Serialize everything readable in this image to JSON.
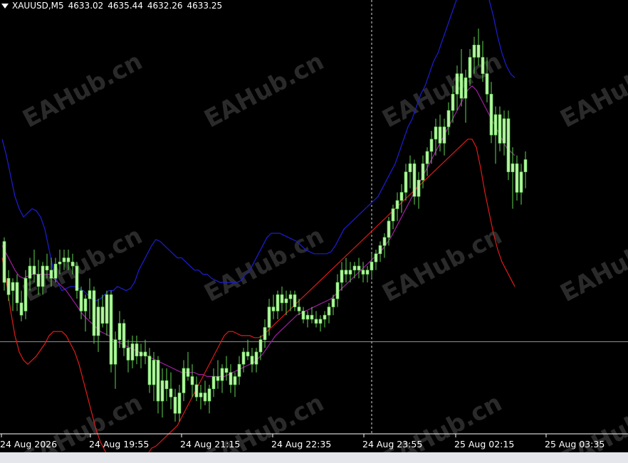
{
  "header": {
    "symbol": "XAUUSD,M5",
    "open": "4633.02",
    "high": "4635.44",
    "low": "4632.26",
    "close": "4633.25"
  },
  "colors": {
    "background": "#000000",
    "candle": "#b4f5a0",
    "wick": "#5fd34f",
    "upper_band": "#1d1dd6",
    "middle_band": "#a01da3",
    "lower_band": "#e01a1a",
    "grid_line": "#8a8f9c",
    "watermark": "#2a2a2a"
  },
  "watermark": "EAHub.cn",
  "chart_data": {
    "type": "candlestick",
    "symbol": "XAUUSD",
    "timeframe": "M5",
    "x_ticks": [
      "24 Aug 2026",
      "24 Aug 19:55",
      "24 Aug 21:15",
      "24 Aug 22:35",
      "24 Aug 23:55",
      "25 Aug 02:15",
      "25 Aug 03:35"
    ],
    "bar_spacing": 6,
    "candles": [
      [
        4674,
        4676,
        4650,
        4654
      ],
      [
        4656,
        4660,
        4645,
        4648
      ],
      [
        4650,
        4656,
        4640,
        4654
      ],
      [
        4654,
        4658,
        4640,
        4644
      ],
      [
        4644,
        4650,
        4635,
        4638
      ],
      [
        4640,
        4660,
        4636,
        4656
      ],
      [
        4656,
        4666,
        4650,
        4662
      ],
      [
        4662,
        4670,
        4654,
        4658
      ],
      [
        4658,
        4665,
        4648,
        4652
      ],
      [
        4652,
        4664,
        4648,
        4662
      ],
      [
        4662,
        4668,
        4656,
        4660
      ],
      [
        4660,
        4666,
        4652,
        4656
      ],
      [
        4656,
        4666,
        4654,
        4663
      ],
      [
        4663,
        4670,
        4658,
        4664
      ],
      [
        4664,
        4670,
        4660,
        4666
      ],
      [
        4666,
        4670,
        4660,
        4664
      ],
      [
        4664,
        4668,
        4658,
        4662
      ],
      [
        4662,
        4664,
        4646,
        4650
      ],
      [
        4650,
        4652,
        4636,
        4640
      ],
      [
        4640,
        4648,
        4630,
        4646
      ],
      [
        4646,
        4656,
        4636,
        4650
      ],
      [
        4650,
        4652,
        4624,
        4628
      ],
      [
        4628,
        4646,
        4620,
        4642
      ],
      [
        4642,
        4648,
        4632,
        4634
      ],
      [
        4634,
        4650,
        4628,
        4648
      ],
      [
        4648,
        4650,
        4610,
        4614
      ],
      [
        4614,
        4630,
        4602,
        4626
      ],
      [
        4626,
        4640,
        4622,
        4634
      ],
      [
        4634,
        4636,
        4618,
        4622
      ],
      [
        4622,
        4626,
        4610,
        4616
      ],
      [
        4616,
        4628,
        4612,
        4624
      ],
      [
        4624,
        4628,
        4614,
        4618
      ],
      [
        4618,
        4624,
        4612,
        4620
      ],
      [
        4620,
        4626,
        4614,
        4618
      ],
      [
        4618,
        4622,
        4600,
        4604
      ],
      [
        4604,
        4620,
        4596,
        4616
      ],
      [
        4616,
        4618,
        4590,
        4596
      ],
      [
        4596,
        4612,
        4588,
        4606
      ],
      [
        4606,
        4612,
        4596,
        4602
      ],
      [
        4602,
        4610,
        4592,
        4598
      ],
      [
        4598,
        4602,
        4586,
        4590
      ],
      [
        4590,
        4604,
        4586,
        4600
      ],
      [
        4600,
        4616,
        4596,
        4612
      ],
      [
        4612,
        4620,
        4606,
        4608
      ],
      [
        4608,
        4614,
        4598,
        4604
      ],
      [
        4604,
        4608,
        4596,
        4598
      ],
      [
        4598,
        4604,
        4592,
        4600
      ],
      [
        4600,
        4606,
        4594,
        4596
      ],
      [
        4596,
        4604,
        4590,
        4602
      ],
      [
        4602,
        4612,
        4598,
        4608
      ],
      [
        4608,
        4616,
        4602,
        4606
      ],
      [
        4606,
        4614,
        4600,
        4612
      ],
      [
        4612,
        4618,
        4606,
        4610
      ],
      [
        4610,
        4614,
        4600,
        4604
      ],
      [
        4604,
        4610,
        4598,
        4608
      ],
      [
        4608,
        4618,
        4604,
        4614
      ],
      [
        4614,
        4622,
        4610,
        4620
      ],
      [
        4620,
        4626,
        4616,
        4618
      ],
      [
        4618,
        4622,
        4610,
        4614
      ],
      [
        4614,
        4622,
        4610,
        4620
      ],
      [
        4620,
        4628,
        4616,
        4626
      ],
      [
        4626,
        4636,
        4622,
        4632
      ],
      [
        4632,
        4646,
        4628,
        4642
      ],
      [
        4642,
        4648,
        4636,
        4640
      ],
      [
        4640,
        4650,
        4636,
        4648
      ],
      [
        4648,
        4652,
        4640,
        4644
      ],
      [
        4644,
        4650,
        4638,
        4646
      ],
      [
        4646,
        4650,
        4640,
        4648
      ],
      [
        4648,
        4650,
        4640,
        4642
      ],
      [
        4642,
        4646,
        4638,
        4640
      ],
      [
        4640,
        4642,
        4634,
        4636
      ],
      [
        4636,
        4640,
        4632,
        4638
      ],
      [
        4638,
        4642,
        4634,
        4636
      ],
      [
        4636,
        4640,
        4632,
        4634
      ],
      [
        4634,
        4638,
        4630,
        4636
      ],
      [
        4636,
        4640,
        4632,
        4638
      ],
      [
        4638,
        4644,
        4634,
        4642
      ],
      [
        4642,
        4648,
        4638,
        4646
      ],
      [
        4646,
        4658,
        4642,
        4654
      ],
      [
        4654,
        4664,
        4650,
        4660
      ],
      [
        4660,
        4666,
        4654,
        4658
      ],
      [
        4658,
        4664,
        4654,
        4660
      ],
      [
        4660,
        4664,
        4656,
        4662
      ],
      [
        4662,
        4666,
        4656,
        4660
      ],
      [
        4660,
        4664,
        4654,
        4658
      ],
      [
        4658,
        4662,
        4654,
        4660
      ],
      [
        4660,
        4668,
        4656,
        4664
      ],
      [
        4664,
        4670,
        4660,
        4668
      ],
      [
        4668,
        4674,
        4664,
        4672
      ],
      [
        4672,
        4678,
        4666,
        4676
      ],
      [
        4676,
        4686,
        4672,
        4684
      ],
      [
        4684,
        4692,
        4680,
        4690
      ],
      [
        4690,
        4698,
        4684,
        4694
      ],
      [
        4694,
        4702,
        4688,
        4698
      ],
      [
        4698,
        4712,
        4694,
        4708
      ],
      [
        4708,
        4716,
        4700,
        4712
      ],
      [
        4712,
        4714,
        4692,
        4696
      ],
      [
        4696,
        4708,
        4690,
        4704
      ],
      [
        4704,
        4716,
        4700,
        4712
      ],
      [
        4712,
        4720,
        4706,
        4718
      ],
      [
        4718,
        4728,
        4712,
        4724
      ],
      [
        4724,
        4734,
        4716,
        4730
      ],
      [
        4730,
        4736,
        4718,
        4722
      ],
      [
        4722,
        4734,
        4716,
        4730
      ],
      [
        4730,
        4742,
        4726,
        4738
      ],
      [
        4738,
        4750,
        4732,
        4746
      ],
      [
        4746,
        4760,
        4738,
        4756
      ],
      [
        4756,
        4768,
        4740,
        4744
      ],
      [
        4744,
        4758,
        4732,
        4754
      ],
      [
        4754,
        4768,
        4750,
        4764
      ],
      [
        4764,
        4774,
        4756,
        4770
      ],
      [
        4770,
        4778,
        4760,
        4764
      ],
      [
        4764,
        4772,
        4752,
        4756
      ],
      [
        4756,
        4764,
        4742,
        4746
      ],
      [
        4746,
        4752,
        4722,
        4726
      ],
      [
        4726,
        4740,
        4712,
        4736
      ],
      [
        4736,
        4740,
        4718,
        4722
      ],
      [
        4722,
        4738,
        4716,
        4734
      ],
      [
        4734,
        4738,
        4704,
        4708
      ],
      [
        4708,
        4720,
        4690,
        4712
      ],
      [
        4712,
        4716,
        4694,
        4698
      ],
      [
        4698,
        4712,
        4692,
        4708
      ],
      [
        4708,
        4718,
        4700,
        4714
      ]
    ],
    "bands": {
      "period_note": "Bollinger Bands",
      "upper": [
        4724,
        4716,
        4706,
        4696,
        4690,
        4686,
        4688,
        4690,
        4689,
        4686,
        4680,
        4670,
        4660,
        4654,
        4650,
        4651,
        4652,
        4652,
        4651,
        4650,
        4648,
        4646,
        4645,
        4646,
        4648,
        4650,
        4650,
        4652,
        4651,
        4650,
        4651,
        4654,
        4660,
        4664,
        4668,
        4672,
        4675,
        4674,
        4672,
        4670,
        4668,
        4666,
        4666,
        4664,
        4662,
        4660,
        4660,
        4658,
        4658,
        4656,
        4655,
        4654,
        4654,
        4654,
        4654,
        4654,
        4655,
        4658,
        4660,
        4664,
        4668,
        4672,
        4676,
        4678,
        4678,
        4678,
        4677,
        4676,
        4675,
        4674,
        4672,
        4670,
        4669,
        4668,
        4668,
        4668,
        4668,
        4669,
        4672,
        4676,
        4680,
        4682,
        4684,
        4686,
        4688,
        4690,
        4692,
        4694,
        4696,
        4700,
        4704,
        4708,
        4712,
        4718,
        4724,
        4730,
        4734,
        4740,
        4746,
        4750,
        4756,
        4762,
        4766,
        4772,
        4778,
        4784,
        4790,
        4796,
        4802,
        4808,
        4812,
        4812,
        4808,
        4800,
        4792,
        4784,
        4774,
        4766,
        4760,
        4756,
        4754
      ],
      "middle": [
        4672,
        4668,
        4664,
        4660,
        4657,
        4656,
        4657,
        4658,
        4658,
        4658,
        4658,
        4658,
        4656,
        4654,
        4652,
        4650,
        4647,
        4644,
        4641,
        4638,
        4636,
        4634,
        4632,
        4630,
        4629,
        4628,
        4626,
        4625,
        4624,
        4623,
        4622,
        4621,
        4620,
        4619,
        4618,
        4617,
        4616,
        4615,
        4614,
        4613,
        4612,
        4611,
        4610,
        4610,
        4610,
        4610,
        4609,
        4609,
        4608,
        4608,
        4608,
        4608,
        4608,
        4609,
        4610,
        4611,
        4612,
        4613,
        4614,
        4615,
        4617,
        4619,
        4622,
        4625,
        4628,
        4630,
        4632,
        4634,
        4636,
        4638,
        4639,
        4640,
        4641,
        4642,
        4643,
        4644,
        4645,
        4646,
        4648,
        4650,
        4652,
        4654,
        4656,
        4658,
        4660,
        4662,
        4664,
        4666,
        4668,
        4670,
        4673,
        4676,
        4680,
        4684,
        4688,
        4692,
        4696,
        4700,
        4704,
        4708,
        4712,
        4716,
        4720,
        4724,
        4728,
        4732,
        4736,
        4740,
        4744,
        4748,
        4750,
        4748,
        4744,
        4740,
        4736,
        4732,
        4728,
        4724,
        4720,
        4718,
        4716
      ],
      "lower": [
        4666,
        4654,
        4640,
        4628,
        4620,
        4616,
        4614,
        4616,
        4618,
        4621,
        4624,
        4628,
        4630,
        4630,
        4630,
        4628,
        4624,
        4620,
        4614,
        4606,
        4598,
        4590,
        4582,
        4576,
        4572,
        4568,
        4566,
        4564,
        4564,
        4562,
        4562,
        4560,
        4562,
        4566,
        4570,
        4573,
        4574,
        4576,
        4578,
        4580,
        4582,
        4584,
        4588,
        4592,
        4596,
        4600,
        4604,
        4608,
        4612,
        4616,
        4620,
        4624,
        4628,
        4630,
        4630,
        4629,
        4628,
        4628,
        4628,
        4627,
        4627,
        4628,
        4630,
        4632,
        4634,
        4636,
        4638,
        4640,
        4642,
        4644,
        4646,
        4648,
        4650,
        4652,
        4654,
        4656,
        4658,
        4660,
        4662,
        4664,
        4666,
        4668,
        4670,
        4672,
        4674,
        4676,
        4678,
        4680,
        4682,
        4684,
        4686,
        4688,
        4690,
        4692,
        4694,
        4696,
        4698,
        4700,
        4702,
        4704,
        4706,
        4708,
        4710,
        4712,
        4714,
        4716,
        4718,
        4720,
        4722,
        4724,
        4724,
        4720,
        4710,
        4698,
        4688,
        4678,
        4670,
        4664,
        4660,
        4656,
        4652
      ]
    },
    "horizontal_line": 4625,
    "vertical_marker_index": 86,
    "ylim": [
      4580,
      4792
    ]
  }
}
